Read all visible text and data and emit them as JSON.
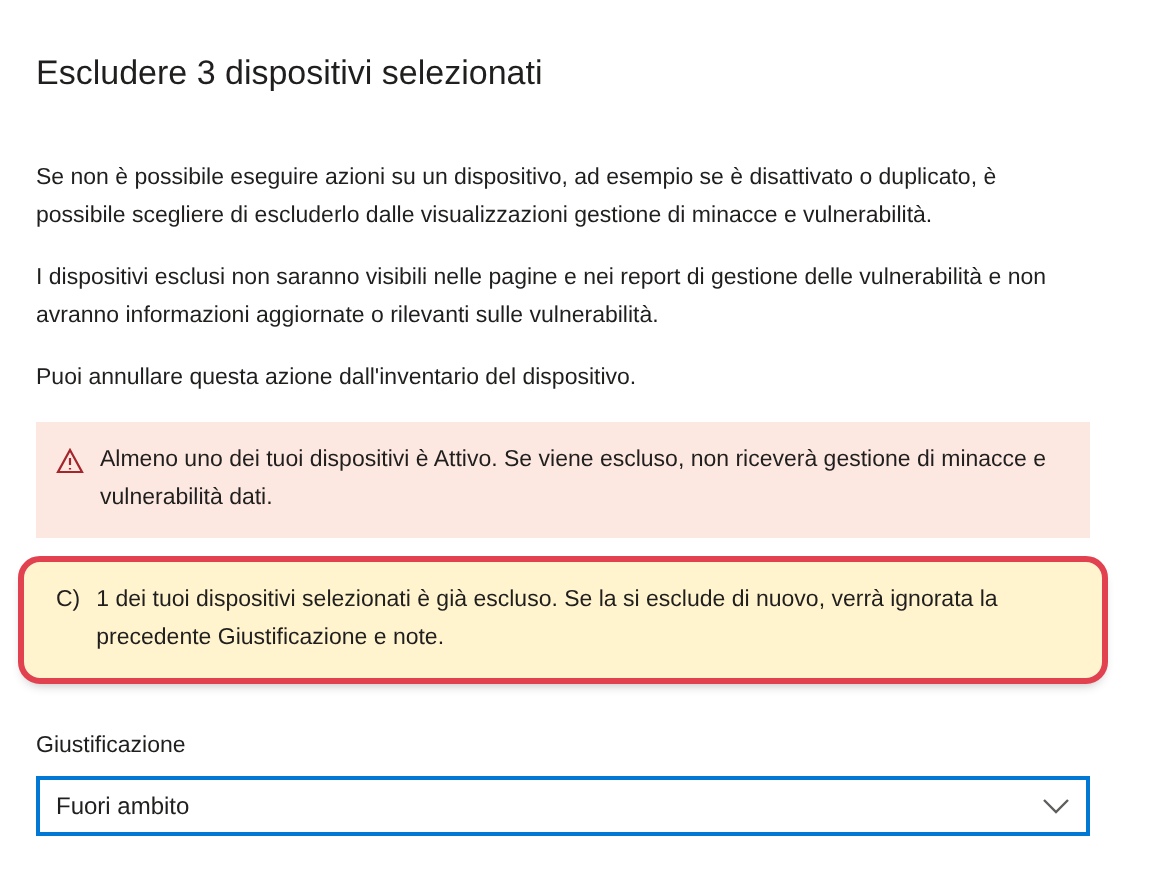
{
  "title": "Escludere 3 dispositivi selezionati",
  "paragraphs": [
    "Se non è possibile eseguire azioni su un dispositivo, ad esempio se è disattivato o duplicato, è possibile scegliere di escluderlo dalle visualizzazioni gestione di minacce e vulnerabilità.",
    "I dispositivi esclusi non saranno visibili nelle pagine e nei report di gestione delle vulnerabilità e non avranno informazioni aggiornate o rilevanti sulle vulnerabilità.",
    "Puoi annullare questa azione dall'inventario del dispositivo."
  ],
  "messages": [
    {
      "kind": "error",
      "text": "Almeno uno dei tuoi dispositivi è Attivo. Se viene escluso, non riceverà gestione di minacce e vulnerabilità dati.",
      "highlighted": false
    },
    {
      "kind": "warning",
      "prefix": "C)",
      "text": "1 dei tuoi dispositivi selezionati è già escluso. Se la si esclude di nuovo, verrà ignorata la precedente Giustificazione e note.",
      "highlighted": true
    }
  ],
  "justification": {
    "label": "Giustificazione",
    "value": "Fuori ambito",
    "focused": true
  }
}
